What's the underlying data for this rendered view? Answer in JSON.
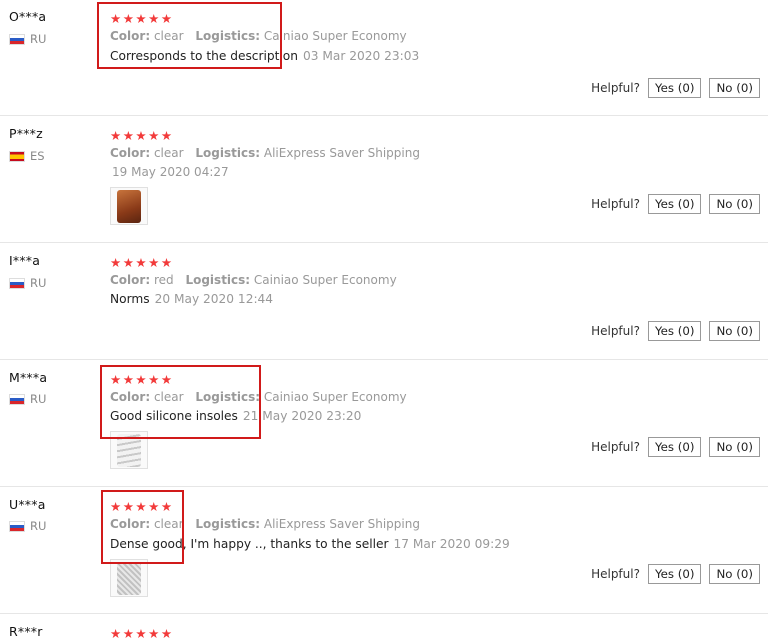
{
  "labels": {
    "color": "Color:",
    "logistics": "Logistics:",
    "helpful": "Helpful?",
    "yes": "Yes (0)",
    "no": "No (0)"
  },
  "reviews": [
    {
      "user": "O***a",
      "country": "RU",
      "flag": "flag-ru",
      "stars": "★★★★★",
      "color": "clear",
      "logistics": "Cainiao Super Economy",
      "text": "Corresponds to the description",
      "date": "03 Mar 2020 23:03",
      "rating": 5
    },
    {
      "user": "P***z",
      "country": "ES",
      "flag": "flag-es",
      "stars": "★★★★★",
      "color": "clear",
      "logistics": "AliExpress Saver Shipping",
      "text": "",
      "date": "19 May 2020 04:27",
      "rating": 5
    },
    {
      "user": "I***a",
      "country": "RU",
      "flag": "flag-ru",
      "stars": "★★★★★",
      "color": "red",
      "logistics": "Cainiao Super Economy",
      "text": "Norms",
      "date": "20 May 2020 12:44",
      "rating": 5
    },
    {
      "user": "M***a",
      "country": "RU",
      "flag": "flag-ru",
      "stars": "★★★★★",
      "color": "clear",
      "logistics": "Cainiao Super Economy",
      "text": "Good silicone insoles",
      "date": "21 May 2020 23:20",
      "rating": 5
    },
    {
      "user": "U***a",
      "country": "RU",
      "flag": "flag-ru",
      "stars": "★★★★★",
      "color": "clear",
      "logistics": "AliExpress Saver Shipping",
      "text": "Dense good, I'm happy .., thanks to the seller",
      "date": "17 Mar 2020 09:29",
      "rating": 5
    },
    {
      "user": "R***r",
      "stars": "★★★★★",
      "rating": 5
    }
  ],
  "colors": {
    "star": "#f23a3a",
    "highlight": "#d11a1a",
    "muted": "#999999"
  },
  "icons": [
    "flag-ru-icon",
    "flag-es-icon",
    "star-icon",
    "review-photo-thumbnail"
  ]
}
